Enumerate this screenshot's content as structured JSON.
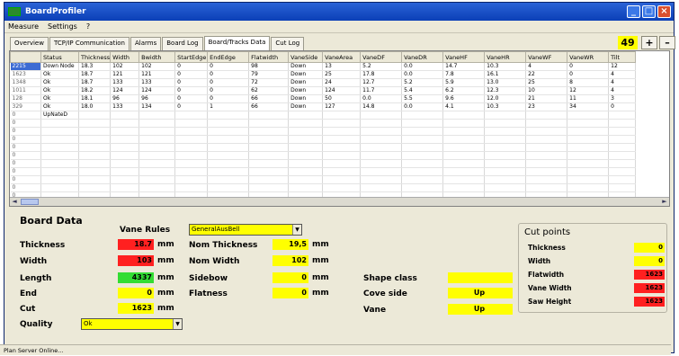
{
  "window": {
    "title": "BoardProfiler"
  },
  "menu": [
    "Measure",
    "Settings",
    "?"
  ],
  "tabs": [
    {
      "label": "Overview"
    },
    {
      "label": "TCP/IP Communication"
    },
    {
      "label": "Alarms"
    },
    {
      "label": "Board Log"
    },
    {
      "label": "Board/Tracks Data"
    },
    {
      "label": "Cut Log"
    }
  ],
  "counter": "49",
  "plus_label": "+",
  "minus_label": "–",
  "table": {
    "columns": [
      "",
      "Status",
      "Thickness",
      "Width",
      "Bwidth",
      "StartEdge",
      "EndEdge",
      "Flatwidth",
      "VaneSide",
      "VaneArea",
      "VaneDF",
      "VaneDR",
      "VaneHF",
      "VaneHR",
      "VaneWF",
      "VaneWR",
      "Tilt"
    ],
    "rows": [
      [
        "2215",
        "Down Node",
        "18.3",
        "102",
        "102",
        "0",
        "0",
        "98",
        "Down",
        "13",
        "5.2",
        "0.0",
        "14.7",
        "10.3",
        "4",
        "0",
        "12"
      ],
      [
        "1623",
        "Ok",
        "18.7",
        "121",
        "121",
        "0",
        "0",
        "79",
        "Down",
        "25",
        "17.8",
        "0.0",
        "7.8",
        "16.1",
        "22",
        "0",
        "4"
      ],
      [
        "1348",
        "Ok",
        "18.7",
        "133",
        "133",
        "0",
        "0",
        "72",
        "Down",
        "24",
        "12.7",
        "5.2",
        "5.9",
        "13.0",
        "25",
        "8",
        "4"
      ],
      [
        "1011",
        "Ok",
        "18.2",
        "124",
        "124",
        "0",
        "0",
        "62",
        "Down",
        "124",
        "11.7",
        "5.4",
        "6.2",
        "12.3",
        "10",
        "12",
        "4"
      ],
      [
        "128",
        "Ok",
        "18.1",
        "96",
        "96",
        "0",
        "0",
        "66",
        "Down",
        "50",
        "0.0",
        "5.5",
        "9.6",
        "12.0",
        "21",
        "11",
        "3"
      ],
      [
        "329",
        "Ok",
        "18.0",
        "133",
        "134",
        "0",
        "1",
        "66",
        "Down",
        "127",
        "14.8",
        "0.0",
        "4.1",
        "10.3",
        "23",
        "34",
        "0"
      ],
      [
        "0",
        "UpNateD",
        "",
        "",
        "",
        "",
        "",
        "",
        "",
        "",
        "",
        "",
        "",
        "",
        "",
        "",
        ""
      ],
      [
        "0",
        "",
        "",
        "",
        "",
        "",
        "",
        "",
        "",
        "",
        "",
        "",
        "",
        "",
        "",
        "",
        ""
      ],
      [
        "0",
        "",
        "",
        "",
        "",
        "",
        "",
        "",
        "",
        "",
        "",
        "",
        "",
        "",
        "",
        "",
        ""
      ],
      [
        "0",
        "",
        "",
        "",
        "",
        "",
        "",
        "",
        "",
        "",
        "",
        "",
        "",
        "",
        "",
        "",
        ""
      ],
      [
        "0",
        "",
        "",
        "",
        "",
        "",
        "",
        "",
        "",
        "",
        "",
        "",
        "",
        "",
        "",
        "",
        ""
      ],
      [
        "0",
        "",
        "",
        "",
        "",
        "",
        "",
        "",
        "",
        "",
        "",
        "",
        "",
        "",
        "",
        "",
        ""
      ],
      [
        "0",
        "",
        "",
        "",
        "",
        "",
        "",
        "",
        "",
        "",
        "",
        "",
        "",
        "",
        "",
        "",
        ""
      ],
      [
        "0",
        "",
        "",
        "",
        "",
        "",
        "",
        "",
        "",
        "",
        "",
        "",
        "",
        "",
        "",
        "",
        ""
      ],
      [
        "0",
        "",
        "",
        "",
        "",
        "",
        "",
        "",
        "",
        "",
        "",
        "",
        "",
        "",
        "",
        "",
        ""
      ],
      [
        "0",
        "",
        "",
        "",
        "",
        "",
        "",
        "",
        "",
        "",
        "",
        "",
        "",
        "",
        "",
        "",
        ""
      ],
      [
        "0",
        "",
        "",
        "",
        "",
        "",
        "",
        "",
        "",
        "",
        "",
        "",
        "",
        "",
        "",
        "",
        ""
      ],
      [
        "0",
        "",
        "",
        "",
        "",
        "",
        "",
        "",
        "",
        "",
        "",
        "",
        "",
        "",
        "",
        "",
        ""
      ]
    ]
  },
  "board": {
    "title": "Board Data",
    "vane_rules_label": "Vane Rules",
    "vane_rules_value": "GeneralAusBell",
    "thickness_label": "Thickness",
    "thickness_value": "18.7",
    "width_label": "Width",
    "width_value": "103",
    "length_label": "Length",
    "length_value": "4337",
    "end_label": "End",
    "end_value": "0",
    "cut_label": "Cut",
    "cut_value": "1623",
    "quality_label": "Quality",
    "quality_value": "Ok",
    "nom_thickness_label": "Nom Thickness",
    "nom_thickness_value": "19,5",
    "nom_width_label": "Nom Width",
    "nom_width_value": "102",
    "sidebow_label": "Sidebow",
    "sidebow_value": "0",
    "flatness_label": "Flatness",
    "flatness_value": "0",
    "shape_class_label": "Shape class",
    "shape_class_value": "",
    "cove_side_label": "Cove side",
    "cove_side_value": "Up",
    "vane_label": "Vane",
    "vane_value": "Up",
    "unit_mm": "mm",
    "colors": {
      "warn": "#ff2020",
      "ok": "#33dd33",
      "field": "#ffff00"
    }
  },
  "cutpoints": {
    "title": "Cut points",
    "items": [
      {
        "label": "Thickness",
        "value": "0",
        "status": "yellow"
      },
      {
        "label": "Width",
        "value": "0",
        "status": "yellow"
      },
      {
        "label": "Flatwidth",
        "value": "1623",
        "status": "red"
      },
      {
        "label": "Vane Width",
        "value": "1623",
        "status": "red"
      },
      {
        "label": "Saw Height",
        "value": "1623",
        "status": "red"
      }
    ]
  },
  "status": {
    "text": "Plan Server Online..."
  }
}
